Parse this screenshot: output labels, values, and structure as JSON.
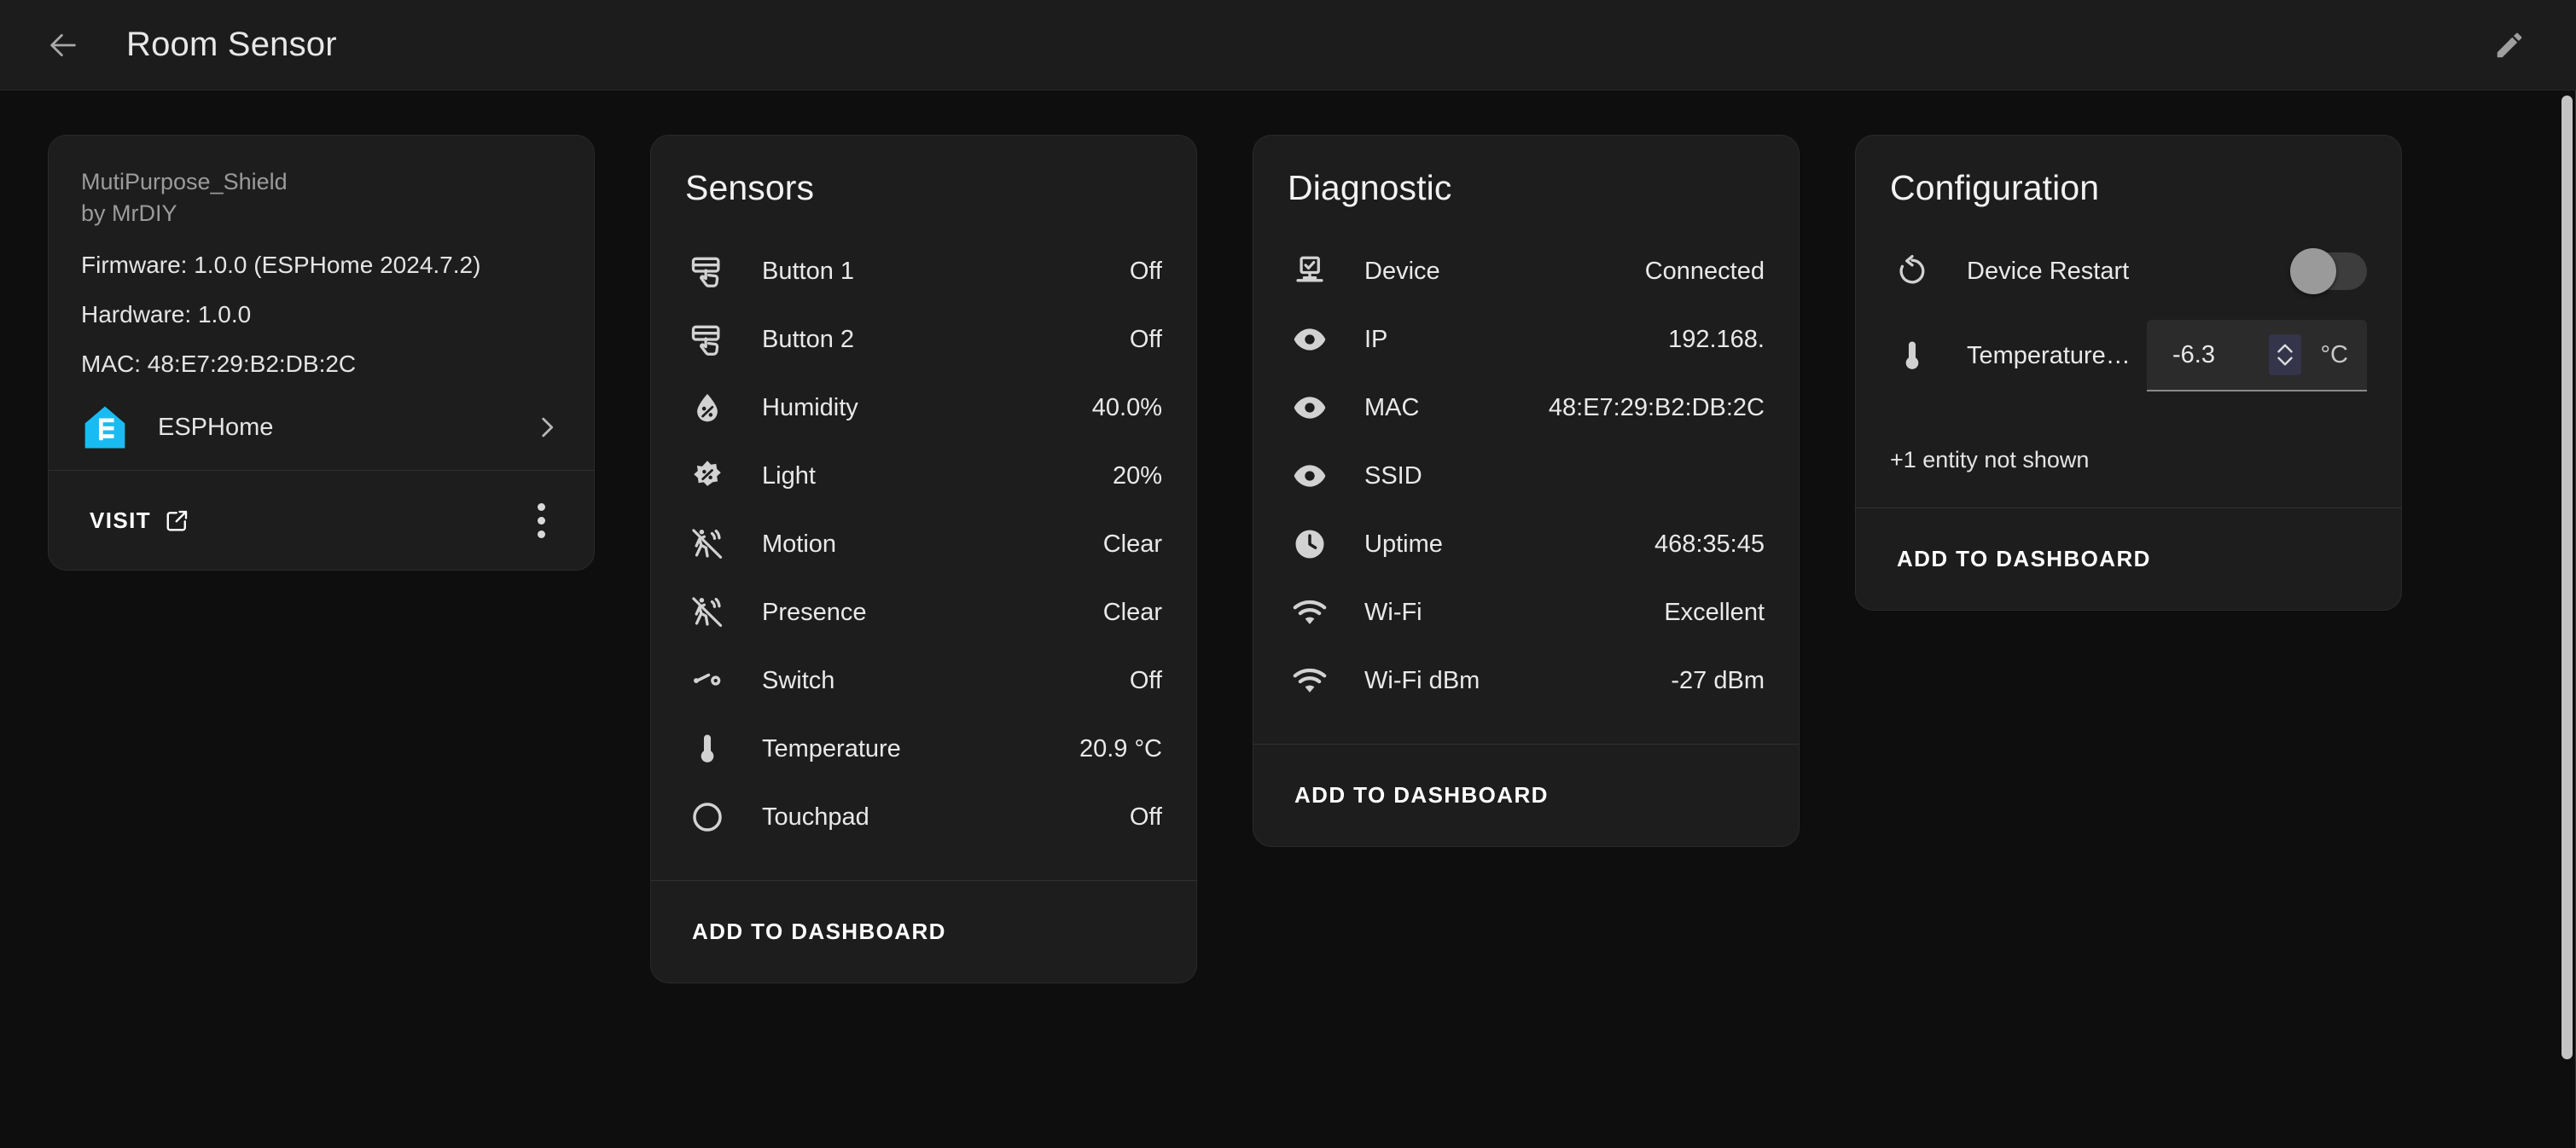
{
  "header": {
    "back_icon": "arrow-left-icon",
    "title": "Room Sensor",
    "edit_icon": "pencil-icon"
  },
  "device_card": {
    "model": "MutiPurpose_Shield",
    "manufacturer": "by MrDIY",
    "firmware": "Firmware: 1.0.0 (ESPHome 2024.7.2)",
    "hardware": "Hardware: 1.0.0",
    "mac": "MAC: 48:E7:29:B2:DB:2C",
    "integration": "ESPHome",
    "visit_label": "VISIT",
    "overflow_icon": "dots-vertical-icon"
  },
  "sensors_card": {
    "title": "Sensors",
    "add_to_dashboard": "ADD TO DASHBOARD",
    "rows": [
      {
        "icon": "gesture-tap-button-icon",
        "name": "Button 1",
        "value": "Off"
      },
      {
        "icon": "gesture-tap-button-icon",
        "name": "Button 2",
        "value": "Off"
      },
      {
        "icon": "water-percent-icon",
        "name": "Humidity",
        "value": "40.0%"
      },
      {
        "icon": "brightness-percent-icon",
        "name": "Light",
        "value": "20%"
      },
      {
        "icon": "motion-sensor-off-icon",
        "name": "Motion",
        "value": "Clear"
      },
      {
        "icon": "motion-sensor-off-icon",
        "name": "Presence",
        "value": "Clear"
      },
      {
        "icon": "toggle-switch-off-icon",
        "name": "Switch",
        "value": "Off"
      },
      {
        "icon": "thermometer-icon",
        "name": "Temperature",
        "value": "20.9 °C"
      },
      {
        "icon": "circle-outline-icon",
        "name": "Touchpad",
        "value": "Off"
      }
    ]
  },
  "diagnostic_card": {
    "title": "Diagnostic",
    "add_to_dashboard": "ADD TO DASHBOARD",
    "rows": [
      {
        "icon": "lan-connect-icon",
        "name": "Device",
        "value": "Connected"
      },
      {
        "icon": "eye-icon",
        "name": "IP",
        "value": "192.168."
      },
      {
        "icon": "eye-icon",
        "name": "MAC",
        "value": "48:E7:29:B2:DB:2C"
      },
      {
        "icon": "eye-icon",
        "name": "SSID",
        "value": ""
      },
      {
        "icon": "clock-icon",
        "name": "Uptime",
        "value": "468:35:45"
      },
      {
        "icon": "wifi-icon",
        "name": "Wi-Fi",
        "value": "Excellent"
      },
      {
        "icon": "wifi-icon",
        "name": "Wi-Fi dBm",
        "value": "-27 dBm"
      }
    ]
  },
  "configuration_card": {
    "title": "Configuration",
    "restart_icon": "restart-icon",
    "restart_label": "Device Restart",
    "restart_state": "off",
    "temperature_icon": "thermometer-icon",
    "temperature_label": "Temperature…",
    "temperature_value": "-6.3",
    "temperature_unit": "°C",
    "entities_not_shown": "+1 entity not shown",
    "add_to_dashboard": "ADD TO DASHBOARD"
  },
  "colors": {
    "page_bg": "#0e0e0e",
    "card_bg": "#1d1d1d",
    "appbar_bg": "#1c1c1c",
    "text_primary": "#e9e9e9",
    "text_muted": "#9b9b9b",
    "esphome_accent": "#18bcf2"
  }
}
